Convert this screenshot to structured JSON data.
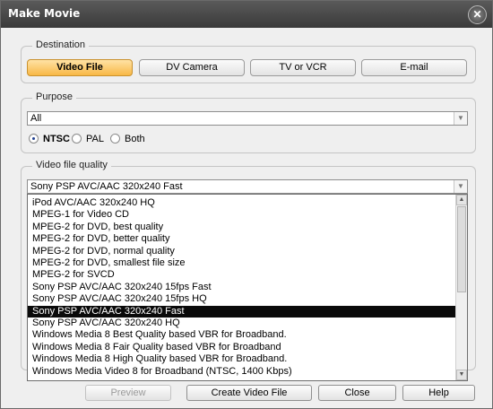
{
  "window": {
    "title": "Make Movie"
  },
  "destination": {
    "label": "Destination",
    "tabs": [
      "Video File",
      "DV Camera",
      "TV or VCR",
      "E-mail"
    ],
    "active": "Video File"
  },
  "purpose": {
    "label": "Purpose",
    "selected": "All",
    "standards": [
      {
        "label": "NTSC",
        "checked": true
      },
      {
        "label": "PAL",
        "checked": false
      },
      {
        "label": "Both",
        "checked": false
      }
    ]
  },
  "quality": {
    "label": "Video file quality",
    "selected": "Sony PSP AVC/AAC 320x240 Fast",
    "options": [
      "iPod AVC/AAC 320x240 HQ",
      "MPEG-1 for Video CD",
      "MPEG-2 for DVD, best quality",
      "MPEG-2 for DVD, better quality",
      "MPEG-2 for DVD, normal quality",
      "MPEG-2 for DVD, smallest file size",
      "MPEG-2 for SVCD",
      "Sony PSP AVC/AAC 320x240 15fps Fast",
      "Sony PSP AVC/AAC 320x240 15fps HQ",
      "Sony PSP AVC/AAC 320x240 Fast",
      "Sony PSP AVC/AAC 320x240 HQ",
      "Windows Media 8 Best Quality based VBR for Broadband.",
      "Windows Media 8 Fair Quality based VBR for Broadband",
      "Windows Media 8 High Quality based VBR for Broadband.",
      "Windows Media Video 8 for Broadband (NTSC, 1400 Kbps)"
    ],
    "highlighted_index": 9
  },
  "buttons": {
    "preview": "Preview",
    "create": "Create Video File",
    "close": "Close",
    "help": "Help"
  },
  "icons": {
    "close": "close-icon",
    "dropdown_arrow": "chevron-down-icon"
  }
}
